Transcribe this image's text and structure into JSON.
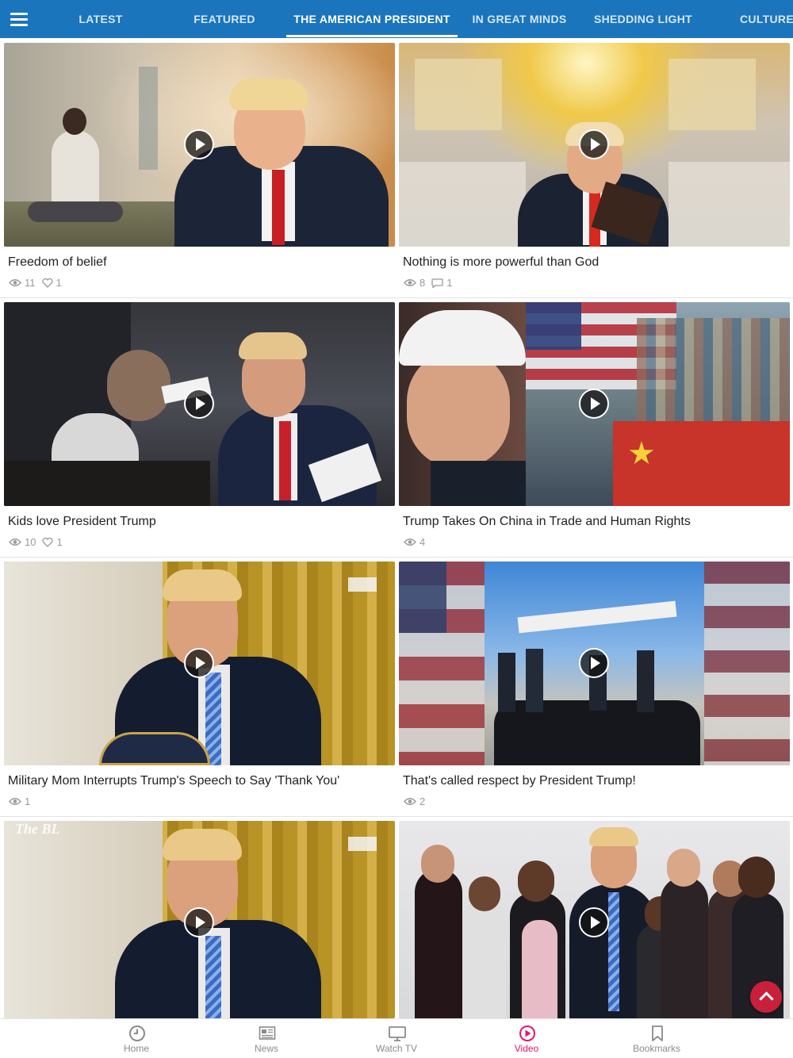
{
  "header": {
    "tabs": [
      {
        "label": "LATEST"
      },
      {
        "label": "FEATURED"
      },
      {
        "label": "THE AMERICAN PRESIDENT"
      },
      {
        "label": "IN GREAT MINDS"
      },
      {
        "label": "SHEDDING LIGHT"
      },
      {
        "label": "CULTURE"
      }
    ],
    "active_tab": "THE AMERICAN PRESIDENT",
    "bar_color": "#1a75bc"
  },
  "videos": [
    {
      "title": "Freedom of belief",
      "views": "11",
      "likes": "1"
    },
    {
      "title": "Nothing is more powerful than God",
      "views": "8",
      "comments": "1"
    },
    {
      "title": "Kids love President Trump",
      "views": "10",
      "likes": "1"
    },
    {
      "title": "Trump Takes On China in Trade and Human Rights",
      "views": "4"
    },
    {
      "title": "Military Mom Interrupts Trump's Speech to Say 'Thank You'",
      "views": "1"
    },
    {
      "title": "That's called respect by President Trump!",
      "views": "2"
    },
    {
      "overlay_text": "The BL"
    },
    {}
  ],
  "bottom_nav": {
    "items": [
      {
        "label": "Home",
        "icon": "clock-icon"
      },
      {
        "label": "News",
        "icon": "newspaper-icon"
      },
      {
        "label": "Watch TV",
        "icon": "tv-icon"
      },
      {
        "label": "Video",
        "icon": "play-circle-icon"
      },
      {
        "label": "Bookmarks",
        "icon": "bookmark-icon"
      }
    ],
    "active": "Video",
    "active_color": "#e0186f"
  },
  "scroll_top_color": "#c8203a"
}
